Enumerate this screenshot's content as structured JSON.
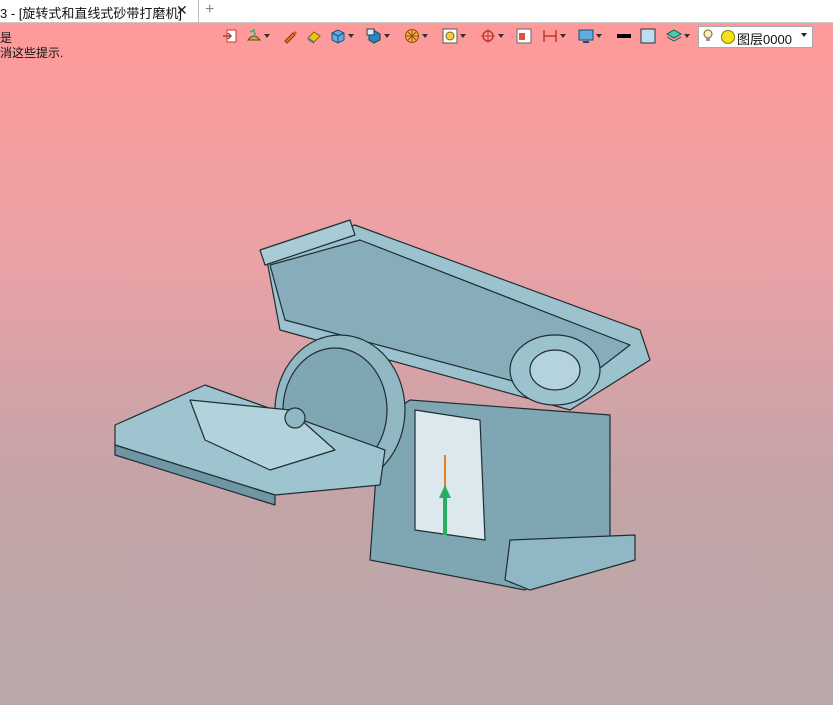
{
  "tab": {
    "title": "3 - [旋转式和直线式砂带打磨机]",
    "close_glyph": "✕",
    "add_glyph": "+"
  },
  "prompt": {
    "line1": "是",
    "line2": "消这些提示."
  },
  "toolbar": {
    "items": [
      {
        "icon": "exit-sketch-icon",
        "dropdown": false
      },
      {
        "icon": "shading-mode-icon",
        "dropdown": true
      },
      {
        "icon": "pencil-icon",
        "dropdown": false
      },
      {
        "icon": "eraser-icon",
        "dropdown": false
      },
      {
        "icon": "solid-box-icon",
        "dropdown": true
      },
      {
        "icon": "view-cube-icon",
        "dropdown": true
      },
      {
        "icon": "render-ball-icon",
        "dropdown": true
      },
      {
        "icon": "zoom-fit-icon",
        "dropdown": true
      },
      {
        "icon": "target-icon",
        "dropdown": true
      },
      {
        "icon": "window-icon",
        "dropdown": false
      },
      {
        "icon": "dimension-icon",
        "dropdown": true
      },
      {
        "icon": "monitor-icon",
        "dropdown": true
      },
      {
        "icon": "line-color-icon",
        "dropdown": false
      },
      {
        "icon": "fill-color-icon",
        "dropdown": false
      },
      {
        "icon": "layer-stack-icon",
        "dropdown": true
      }
    ],
    "layer": {
      "name": "图层0000",
      "dot_color": "#f5e11a"
    }
  },
  "colors": {
    "viewport_top": "#ff9a9a",
    "viewport_bottom": "#b7a9a8",
    "model_body": "#8fb7c4",
    "model_edge": "#1f2e33"
  }
}
